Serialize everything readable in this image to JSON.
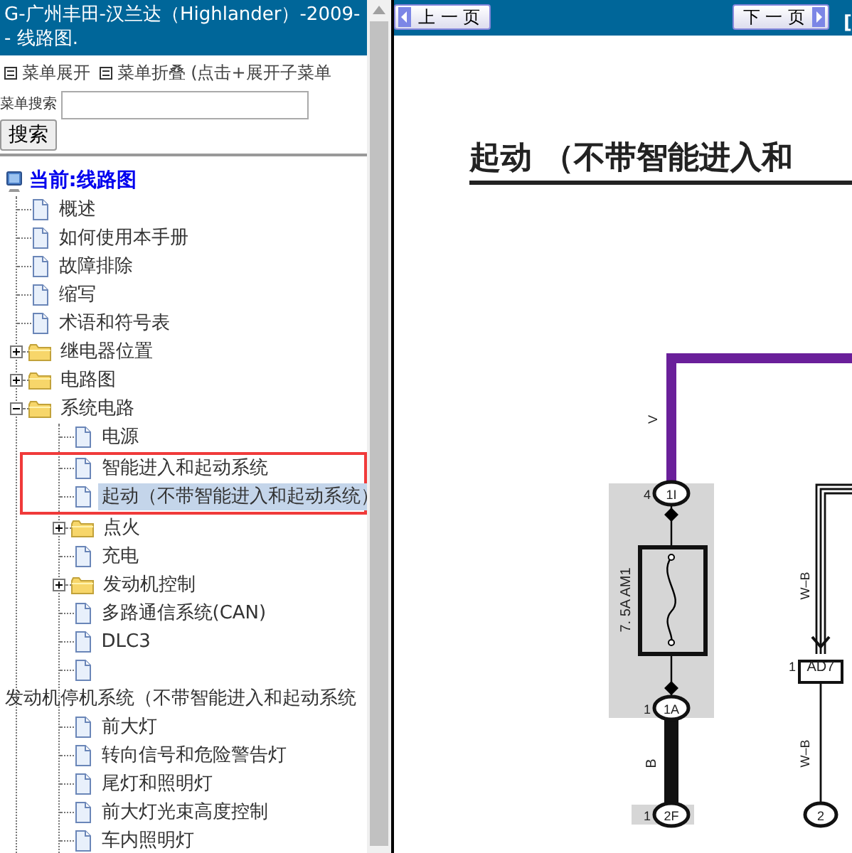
{
  "sidebar": {
    "title": "G-广州丰田-汉兰达（Highlander）-2009-- 线路图.",
    "menu_links": [
      "菜单展开",
      "菜单折叠 (点击+展开子菜单"
    ],
    "search": {
      "label": "菜单搜索",
      "button": "搜索"
    },
    "tree": [
      {
        "kind": "root",
        "label": "当前:线路图",
        "children": [
          {
            "kind": "doc",
            "label": "概述",
            "selected": false,
            "boxed": false
          },
          {
            "kind": "doc",
            "label": "如何使用本手册",
            "selected": false,
            "boxed": false
          },
          {
            "kind": "doc",
            "label": "故障排除",
            "selected": false,
            "boxed": false
          },
          {
            "kind": "doc",
            "label": "缩写",
            "selected": false,
            "boxed": false
          },
          {
            "kind": "doc",
            "label": "术语和符号表",
            "selected": false,
            "boxed": false
          },
          {
            "kind": "folder",
            "label": "继电器位置",
            "expanded": false,
            "selected": false,
            "boxed": false
          },
          {
            "kind": "folder",
            "label": "电路图",
            "expanded": false,
            "selected": false,
            "boxed": false
          },
          {
            "kind": "folder",
            "label": "系统电路",
            "expanded": true,
            "selected": false,
            "boxed": false,
            "children": [
              {
                "kind": "doc",
                "label": "电源",
                "selected": false,
                "boxed": false
              },
              {
                "kind": "doc",
                "label": "智能进入和起动系统",
                "selected": false,
                "boxed": true
              },
              {
                "kind": "doc",
                "label": "起动（不带智能进入和起动系统）",
                "selected": true,
                "boxed": true
              },
              {
                "kind": "folder",
                "label": "点火",
                "expanded": false,
                "selected": false,
                "boxed": false
              },
              {
                "kind": "doc",
                "label": "充电",
                "selected": false,
                "boxed": false
              },
              {
                "kind": "folder",
                "label": "发动机控制",
                "expanded": false,
                "selected": false,
                "boxed": false
              },
              {
                "kind": "doc",
                "label": "多路通信系统(CAN)",
                "selected": false,
                "boxed": false
              },
              {
                "kind": "doc",
                "label": "DLC3",
                "selected": false,
                "boxed": false
              },
              {
                "kind": "doc-wrapped",
                "label": "发动机停机系统（不带智能进入和起动系统",
                "selected": false,
                "boxed": false
              },
              {
                "kind": "doc",
                "label": "前大灯",
                "selected": false,
                "boxed": false
              },
              {
                "kind": "doc",
                "label": "转向信号和危险警告灯",
                "selected": false,
                "boxed": false
              },
              {
                "kind": "doc",
                "label": "尾灯和照明灯",
                "selected": false,
                "boxed": false
              },
              {
                "kind": "doc",
                "label": "前大灯光束高度控制",
                "selected": false,
                "boxed": false
              },
              {
                "kind": "doc",
                "label": "车内照明灯",
                "selected": false,
                "boxed": false
              }
            ]
          }
        ]
      }
    ]
  },
  "viewer": {
    "prev": "上 一 页",
    "next": "下 一 页",
    "extra": "[",
    "heading": "起动 （不带智能进入和",
    "diagram": {
      "labels": [
        {
          "text": "V"
        },
        {
          "text": "4"
        },
        {
          "text": "1I"
        },
        {
          "text": "7. 5A AM1"
        },
        {
          "text": "1"
        },
        {
          "text": "1A"
        },
        {
          "text": "B"
        },
        {
          "text": "1"
        },
        {
          "text": "2F"
        },
        {
          "text": "W–B"
        },
        {
          "text": "1"
        },
        {
          "text": "AD7"
        },
        {
          "text": "W–B"
        },
        {
          "text": "2"
        }
      ]
    }
  }
}
